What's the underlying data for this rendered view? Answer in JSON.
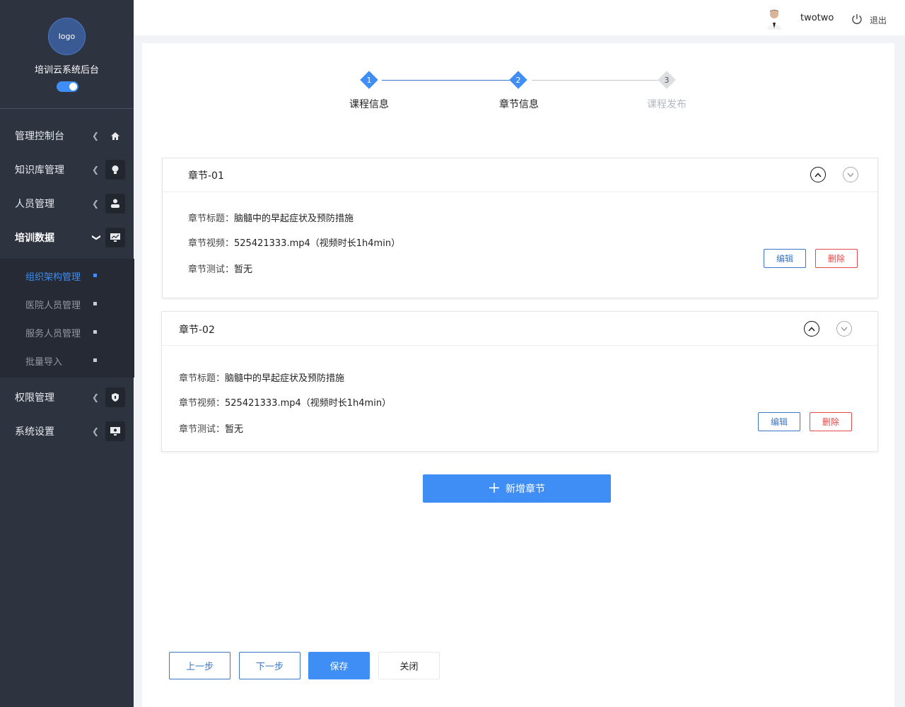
{
  "sidebar": {
    "logo_text": "logo",
    "system_title": "培训云系统后台",
    "items": [
      {
        "label": "管理控制台",
        "icon": "home-icon"
      },
      {
        "label": "知识库管理",
        "icon": "lightbulb-icon"
      },
      {
        "label": "人员管理",
        "icon": "users-icon"
      },
      {
        "label": "培训数据",
        "icon": "monitor-chart-icon"
      },
      {
        "label": "权限管理",
        "icon": "shield-icon"
      },
      {
        "label": "系统设置",
        "icon": "settings-monitor-icon"
      }
    ],
    "submenu": [
      {
        "label": "组织架构管理",
        "active": true
      },
      {
        "label": "医院人员管理",
        "active": false
      },
      {
        "label": "服务人员管理",
        "active": false
      },
      {
        "label": "批量导入",
        "active": false
      }
    ]
  },
  "topbar": {
    "username": "twotwo",
    "logout": "退出"
  },
  "steps": [
    {
      "num": "1",
      "label": "课程信息",
      "state": "done"
    },
    {
      "num": "2",
      "label": "章节信息",
      "state": "current"
    },
    {
      "num": "3",
      "label": "课程发布",
      "state": "pending"
    }
  ],
  "chapters": [
    {
      "title": "章节-01",
      "title_label": "章节标题：",
      "title_value": "脑髓中的早起症状及预防措施",
      "video_label": "章节视频：",
      "video_value": "525421333.mp4（视频时长1h4min）",
      "test_label": "章节测试：",
      "test_value": "暂无",
      "edit": "编辑",
      "delete": "删除"
    },
    {
      "title": "章节-02",
      "title_label": "章节标题：",
      "title_value": "脑髓中的早起症状及预防措施",
      "video_label": "章节视频：",
      "video_value": "525421333.mp4（视频时长1h4min）",
      "test_label": "章节测试：",
      "test_value": "暂无",
      "edit": "编辑",
      "delete": "删除"
    }
  ],
  "add_chapter": "新增章节",
  "footer": {
    "prev": "上一步",
    "next": "下一步",
    "save": "保存",
    "close": "关闭"
  },
  "colors": {
    "accent": "#3e8ef5",
    "sidebar_bg": "#2e3340",
    "danger": "#e04a4a"
  }
}
